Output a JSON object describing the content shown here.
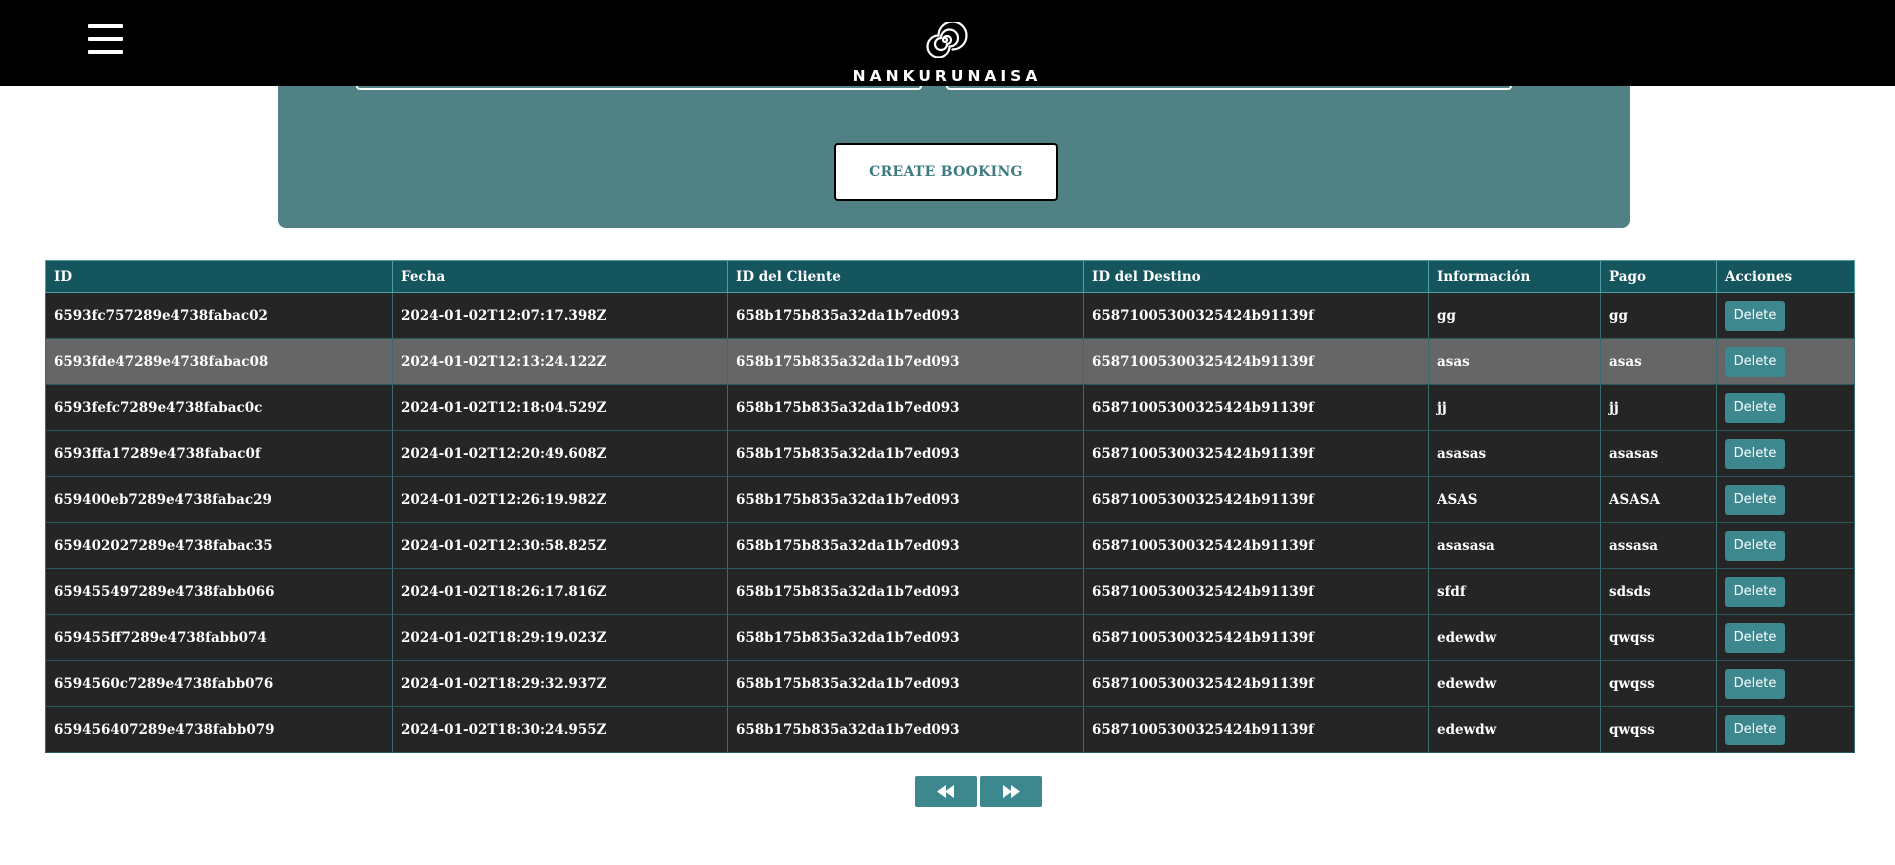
{
  "header": {
    "brand": "NANKURUNAISA",
    "menu_icon": "hamburger-menu-icon",
    "logo_icon": "spiral-logo-icon"
  },
  "form": {
    "create_button_label": "CREATE BOOKING"
  },
  "table": {
    "columns": [
      "ID",
      "Fecha",
      "ID del Cliente",
      "ID del Destino",
      "Información",
      "Pago",
      "Acciones"
    ],
    "rows": [
      {
        "id": "6593fc757289e4738fabac02",
        "fecha": "2024-01-02T12:07:17.398Z",
        "cliente": "658b175b835a32da1b7ed093",
        "destino": "65871005300325424b91139f",
        "info": "gg",
        "pago": "gg",
        "action": "Delete"
      },
      {
        "id": "6593fde47289e4738fabac08",
        "fecha": "2024-01-02T12:13:24.122Z",
        "cliente": "658b175b835a32da1b7ed093",
        "destino": "65871005300325424b91139f",
        "info": "asas",
        "pago": "asas",
        "action": "Delete"
      },
      {
        "id": "6593fefc7289e4738fabac0c",
        "fecha": "2024-01-02T12:18:04.529Z",
        "cliente": "658b175b835a32da1b7ed093",
        "destino": "65871005300325424b91139f",
        "info": "jj",
        "pago": "jj",
        "action": "Delete"
      },
      {
        "id": "6593ffa17289e4738fabac0f",
        "fecha": "2024-01-02T12:20:49.608Z",
        "cliente": "658b175b835a32da1b7ed093",
        "destino": "65871005300325424b91139f",
        "info": "asasas",
        "pago": "asasas",
        "action": "Delete"
      },
      {
        "id": "659400eb7289e4738fabac29",
        "fecha": "2024-01-02T12:26:19.982Z",
        "cliente": "658b175b835a32da1b7ed093",
        "destino": "65871005300325424b91139f",
        "info": "ASAS",
        "pago": "ASASA",
        "action": "Delete"
      },
      {
        "id": "659402027289e4738fabac35",
        "fecha": "2024-01-02T12:30:58.825Z",
        "cliente": "658b175b835a32da1b7ed093",
        "destino": "65871005300325424b91139f",
        "info": "asasasa",
        "pago": "assasa",
        "action": "Delete"
      },
      {
        "id": "659455497289e4738fabb066",
        "fecha": "2024-01-02T18:26:17.816Z",
        "cliente": "658b175b835a32da1b7ed093",
        "destino": "65871005300325424b91139f",
        "info": "sfdf",
        "pago": "sdsds",
        "action": "Delete"
      },
      {
        "id": "659455ff7289e4738fabb074",
        "fecha": "2024-01-02T18:29:19.023Z",
        "cliente": "658b175b835a32da1b7ed093",
        "destino": "65871005300325424b91139f",
        "info": "edewdw",
        "pago": "qwqss",
        "action": "Delete"
      },
      {
        "id": "6594560c7289e4738fabb076",
        "fecha": "2024-01-02T18:29:32.937Z",
        "cliente": "658b175b835a32da1b7ed093",
        "destino": "65871005300325424b91139f",
        "info": "edewdw",
        "pago": "qwqss",
        "action": "Delete"
      },
      {
        "id": "659456407289e4738fabb079",
        "fecha": "2024-01-02T18:30:24.955Z",
        "cliente": "658b175b835a32da1b7ed093",
        "destino": "65871005300325424b91139f",
        "info": "edewdw",
        "pago": "qwqss",
        "action": "Delete"
      }
    ],
    "highlighted_row": 1
  },
  "pagination": {
    "prev_icon": "rewind-icon",
    "next_icon": "fast-forward-icon"
  },
  "colors": {
    "header_bg": "#000000",
    "panel_bg": "#4f8185",
    "table_header_bg": "#14555e",
    "row_bg": "#252525",
    "row_highlight_bg": "#666666",
    "button_bg": "#3d878e",
    "create_text": "#3d7b83"
  }
}
